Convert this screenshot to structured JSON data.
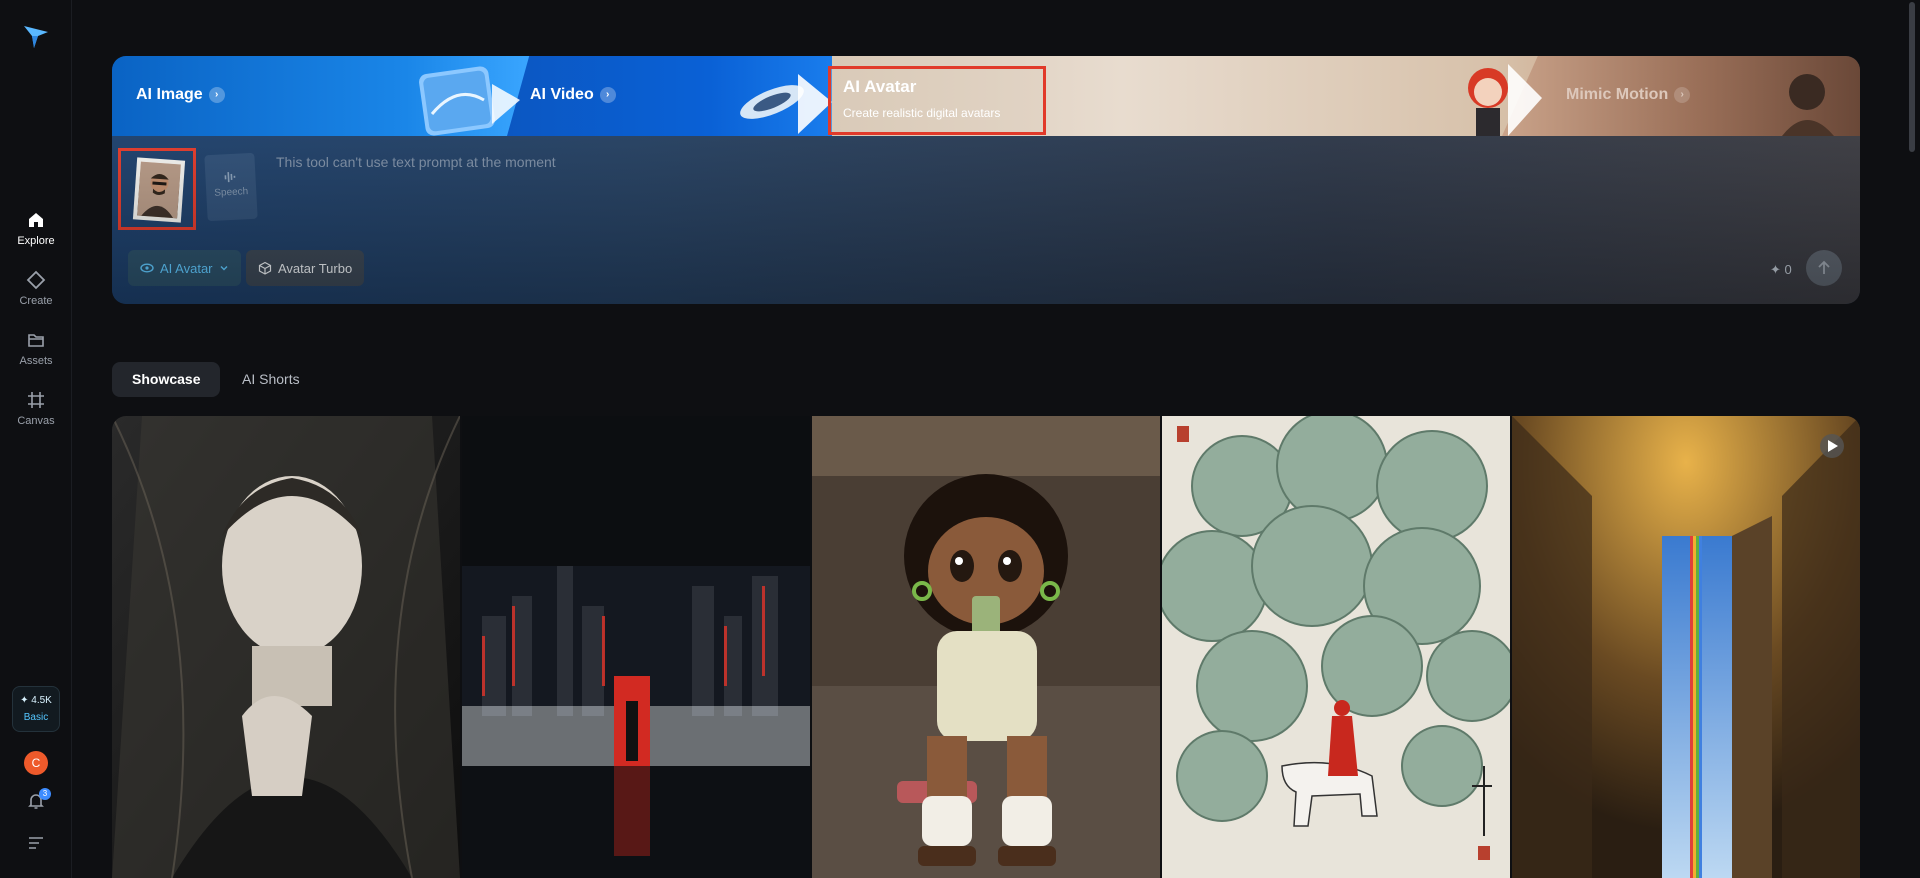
{
  "sidebar": {
    "nav": [
      {
        "label": "Explore",
        "icon": "home-icon",
        "active": true
      },
      {
        "label": "Create",
        "icon": "diamond-icon",
        "active": false
      },
      {
        "label": "Assets",
        "icon": "folder-icon",
        "active": false
      },
      {
        "label": "Canvas",
        "icon": "canvas-icon",
        "active": false
      }
    ],
    "credits": {
      "amount": "✦ 4.5K",
      "plan": "Basic"
    },
    "user_initial": "C",
    "notifications": "3"
  },
  "hero": {
    "tabs": [
      {
        "label": "AI Image"
      },
      {
        "label": "AI Video"
      },
      {
        "label": "AI Avatar",
        "subtitle": "Create realistic digital avatars"
      },
      {
        "label": "Mimic Motion"
      }
    ],
    "speech_label": "Speech",
    "prompt_placeholder": "This tool can't use text prompt at the moment",
    "model_chip": "AI Avatar",
    "version_chip": "Avatar Turbo",
    "credit_cost": "✦ 0"
  },
  "showcase": {
    "tabs": [
      "Showcase",
      "AI Shorts"
    ]
  },
  "colors": {
    "accent": "#54c6ff",
    "highlight": "#e13a2a",
    "background": "#0e0f12"
  }
}
